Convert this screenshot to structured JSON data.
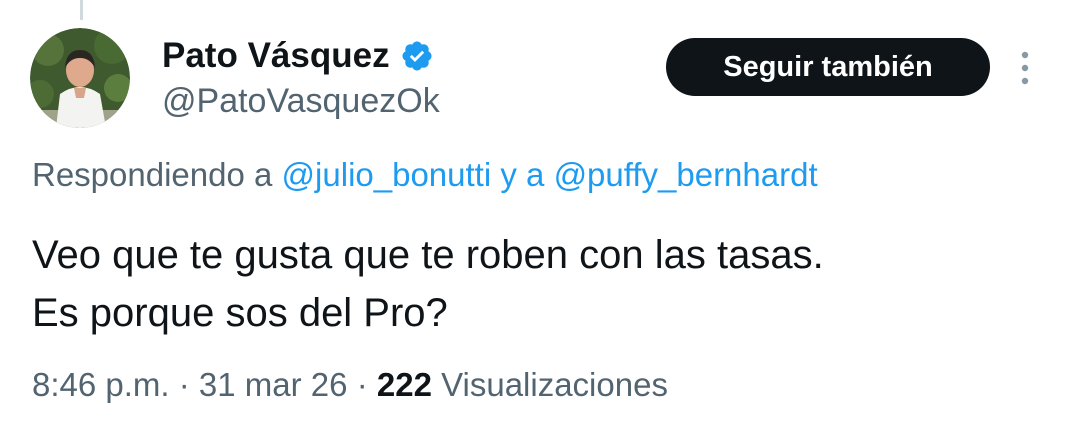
{
  "author": {
    "display_name": "Pato Vásquez",
    "handle": "@PatoVasquezOk",
    "verified": true,
    "verified_color": "#1d9bf0"
  },
  "follow_button": {
    "label": "Seguir también"
  },
  "reply_context": {
    "prefix": "Respondiendo a",
    "mention_1": "@julio_bonutti",
    "conjunction": "y a",
    "mention_2": "@puffy_bernhardt"
  },
  "tweet": {
    "line_1": "Veo que te gusta que te roben con las tasas.",
    "line_2": "Es porque sos del Pro?"
  },
  "meta": {
    "time": "8:46 p.m.",
    "separator": "·",
    "date": "31 mar 26",
    "views_count": "222",
    "views_label": "Visualizaciones"
  },
  "icons": {
    "verified": "verified-badge-icon",
    "more": "more-vertical-icon"
  },
  "colors": {
    "text_primary": "#0f1419",
    "text_secondary": "#536471",
    "link": "#1d9bf0",
    "button_bg": "#0f1419"
  }
}
